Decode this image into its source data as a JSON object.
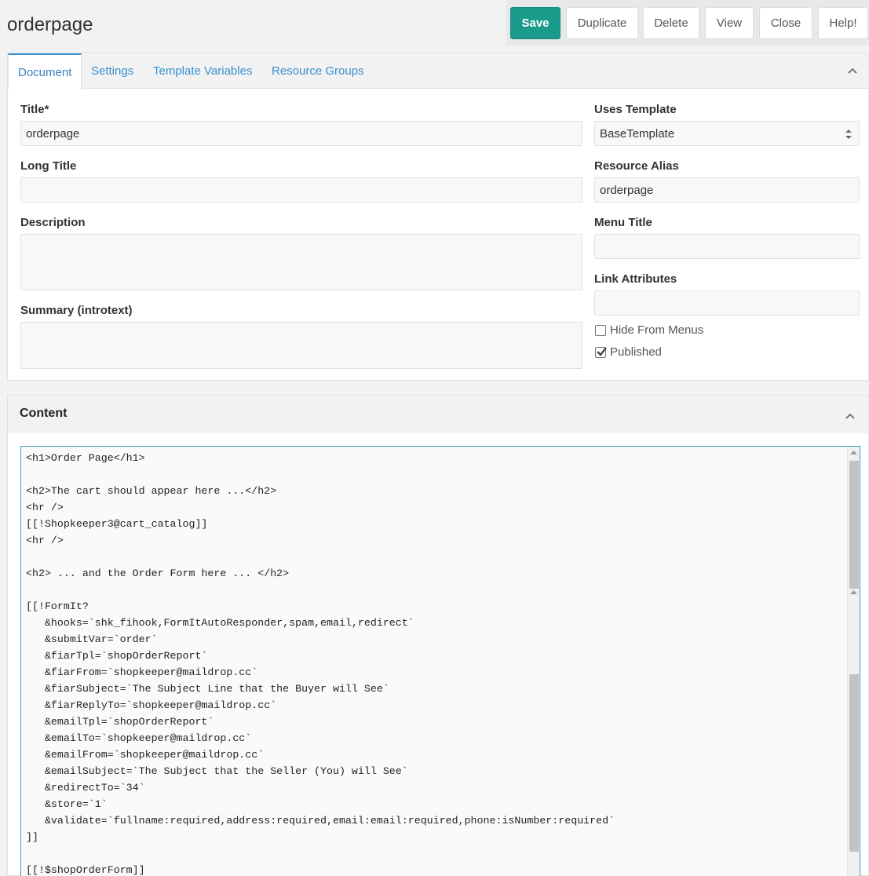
{
  "page": {
    "title": "orderpage"
  },
  "actions": {
    "save": "Save",
    "duplicate": "Duplicate",
    "delete": "Delete",
    "view": "View",
    "close": "Close",
    "help": "Help!"
  },
  "tabs": [
    "Document",
    "Settings",
    "Template Variables",
    "Resource Groups"
  ],
  "form": {
    "title_label": "Title*",
    "title_value": "orderpage",
    "long_title_label": "Long Title",
    "long_title_value": "",
    "description_label": "Description",
    "description_value": "",
    "summary_label": "Summary (introtext)",
    "summary_value": "",
    "template_label": "Uses Template",
    "template_value": "BaseTemplate",
    "alias_label": "Resource Alias",
    "alias_value": "orderpage",
    "menu_title_label": "Menu Title",
    "menu_title_value": "",
    "link_attr_label": "Link Attributes",
    "link_attr_value": "",
    "hide_menus_label": "Hide From Menus",
    "hide_menus_checked": false,
    "published_label": "Published",
    "published_checked": true
  },
  "content": {
    "title": "Content",
    "lines": [
      "<h1>Order Page</h1>",
      "",
      "<h2>The cart should appear here ...</h2>",
      "<hr />",
      "[[!Shopkeeper3@cart_catalog]]",
      "<hr />",
      "",
      "<h2> ... and the Order Form here ... </h2>",
      "",
      "[[!FormIt?",
      "   &hooks=`shk_fihook,FormItAutoResponder,spam,email,redirect`",
      "   &submitVar=`order`",
      "   &fiarTpl=`shopOrderReport`",
      "   &fiarFrom=`shopkeeper@maildrop.cc`",
      "   &fiarSubject=`The Subject Line that the Buyer will See`",
      "   &fiarReplyTo=`shopkeeper@maildrop.cc`",
      "   &emailTpl=`shopOrderReport`",
      "   &emailTo=`shopkeeper@maildrop.cc`",
      "   &emailFrom=`shopkeeper@maildrop.cc`",
      "   &emailSubject=`The Subject that the Seller (You) will See`",
      "   &redirectTo=`34`",
      "   &store=`1`",
      "   &validate=`fullname:required,address:required,email:email:required,phone:isNumber:required`",
      "]]",
      "",
      "[[!$shopOrderForm]]"
    ]
  },
  "colors": {
    "primary": "#1a9a8a",
    "link": "#3a8fcc",
    "editor_border": "#3a9ac8"
  },
  "icons": {
    "collapse": "chevron-up-icon",
    "select": "select-arrows-icon",
    "check": "check-icon"
  }
}
